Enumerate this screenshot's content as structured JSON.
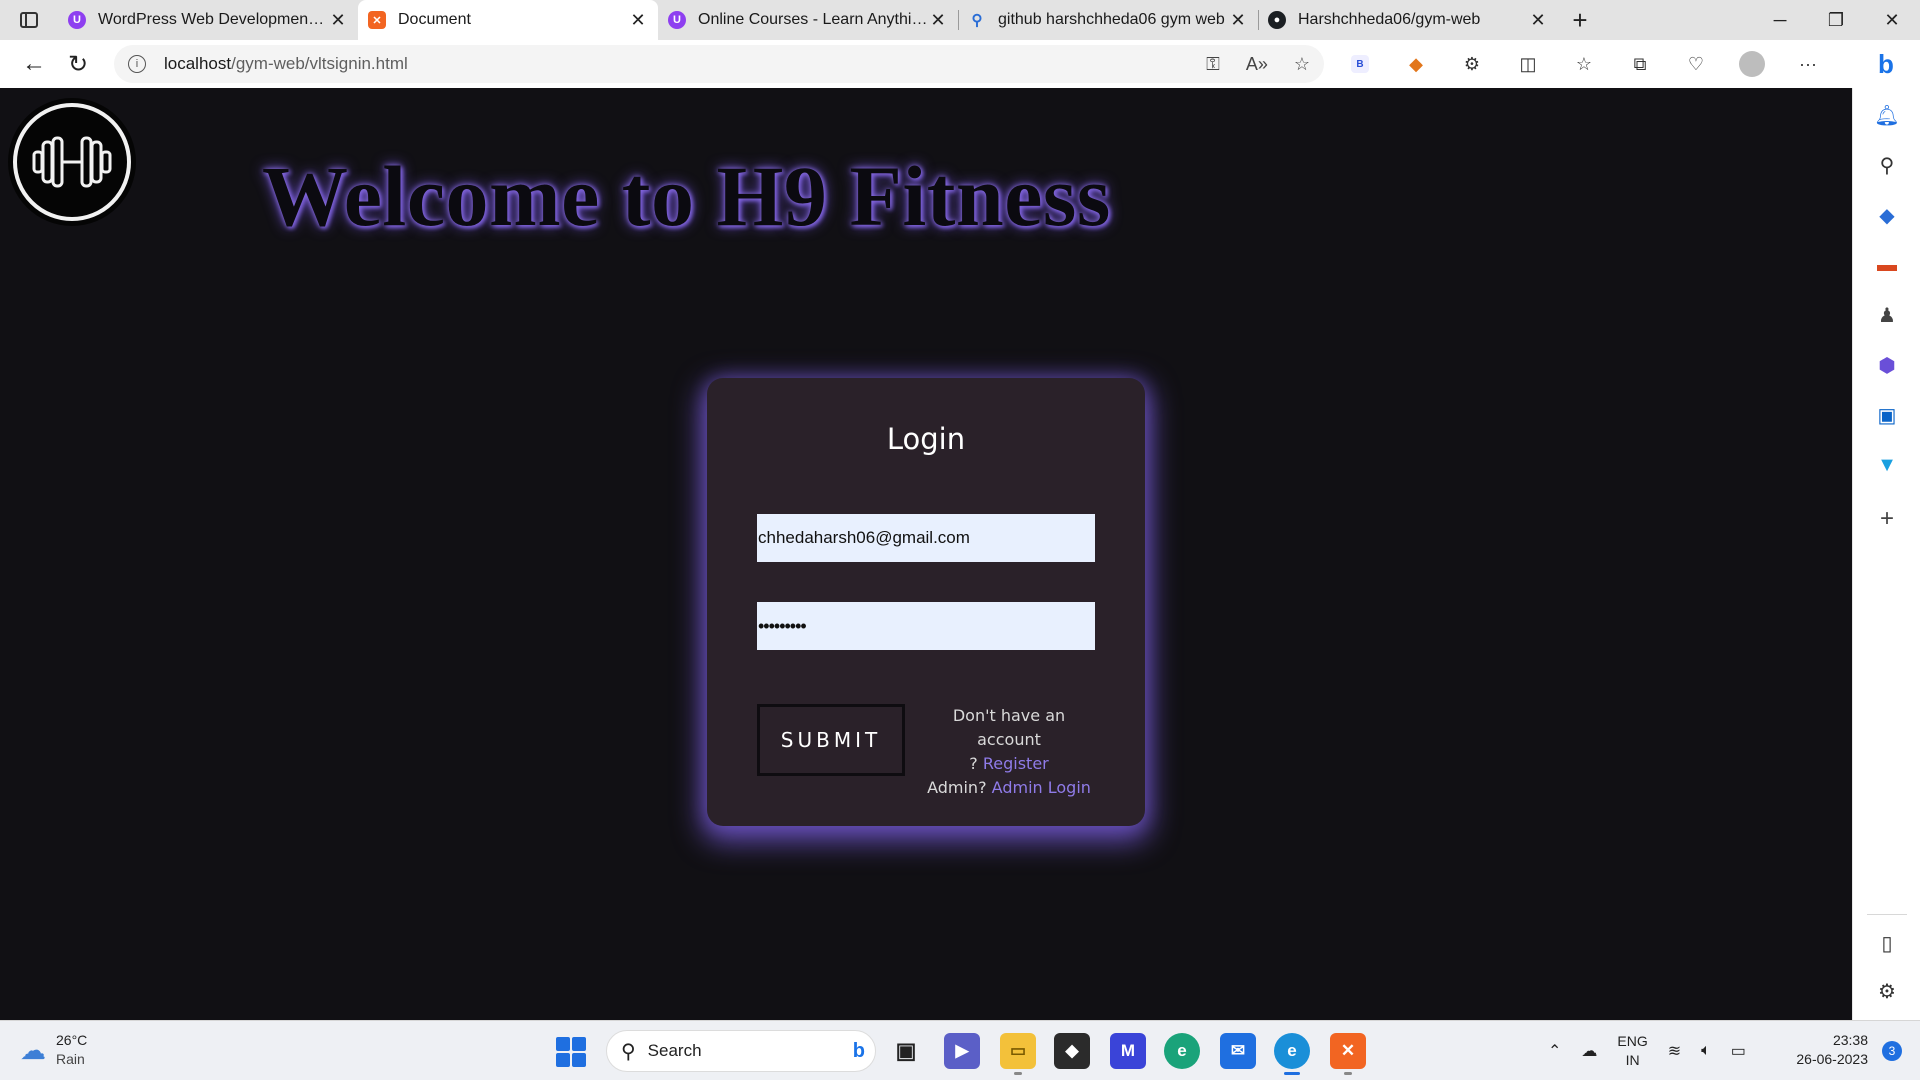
{
  "browser": {
    "tabs": [
      {
        "title": "WordPress Web Development Co",
        "favicon": "udemy-icon",
        "active": false
      },
      {
        "title": "Document",
        "favicon": "xampp-icon",
        "active": true
      },
      {
        "title": "Online Courses - Learn Anything,",
        "favicon": "udemy-icon",
        "active": false
      },
      {
        "title": "github harshchheda06 gym web",
        "favicon": "search-icon",
        "active": false
      },
      {
        "title": "Harshchheda06/gym-web",
        "favicon": "github-icon",
        "active": false
      }
    ],
    "url_host": "localhost",
    "url_path": "/gym-web/vltsignin.html"
  },
  "page": {
    "headline": "Welcome to H9 Fitness",
    "login": {
      "title": "Login",
      "email_value": "chhedaharsh06@gmail.com",
      "password_mask": "•••••••••",
      "submit_label": "SUBMIT",
      "no_account_text": "Don't have an account",
      "question_mark": "?",
      "register_link": "Register",
      "admin_text": "Admin?",
      "admin_link": "Admin Login"
    }
  },
  "taskbar": {
    "weather_temp": "26°C",
    "weather_desc": "Rain",
    "search_placeholder": "Search",
    "lang_top": "ENG",
    "lang_bottom": "IN",
    "time": "23:38",
    "date": "26-06-2023",
    "notification_count": "3"
  },
  "colors": {
    "page_bg": "#111014",
    "card_bg": "#2a2129",
    "glow": "#7a5ddc",
    "link": "#8f7be8",
    "input_bg": "#e8f0fe"
  }
}
